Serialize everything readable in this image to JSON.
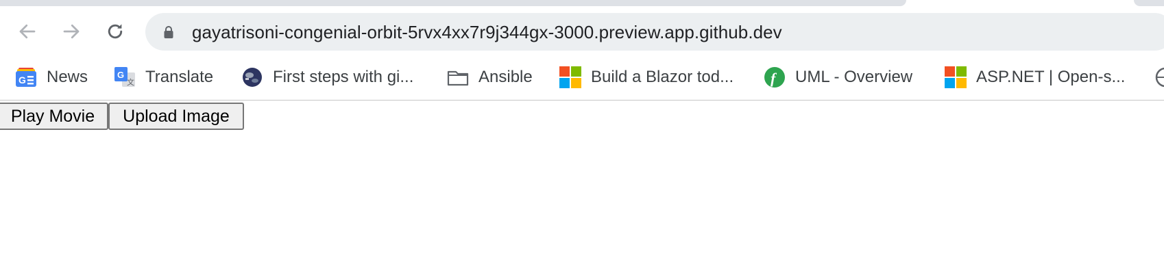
{
  "browser": {
    "address_bar": {
      "url": "gayatrisoni-congenial-orbit-5rvx4xx7r9j344gx-3000.preview.app.github.dev",
      "lock_icon": "lock-icon"
    },
    "nav": {
      "back_icon": "arrow-left-icon",
      "forward_icon": "arrow-right-icon",
      "reload_icon": "reload-icon"
    },
    "bookmarks": [
      {
        "label": "News",
        "icon": "google-news-icon"
      },
      {
        "label": "Translate",
        "icon": "google-translate-icon"
      },
      {
        "label": "First steps with gi...",
        "icon": "globe-favicon"
      },
      {
        "label": "Ansible",
        "icon": "folder-icon"
      },
      {
        "label": "Build a Blazor tod...",
        "icon": "microsoft-logo-icon"
      },
      {
        "label": "UML - Overview",
        "icon": "f-circle-icon"
      },
      {
        "label": "ASP.NET | Open-s...",
        "icon": "microsoft-logo-icon"
      }
    ]
  },
  "page": {
    "buttons": {
      "play_movie": "Play Movie",
      "upload_image": "Upload Image"
    }
  },
  "colors": {
    "tabstrip": "#dee1e6",
    "omnibox": "#eceff1",
    "button_bg": "#efefef",
    "button_border": "#767676"
  }
}
